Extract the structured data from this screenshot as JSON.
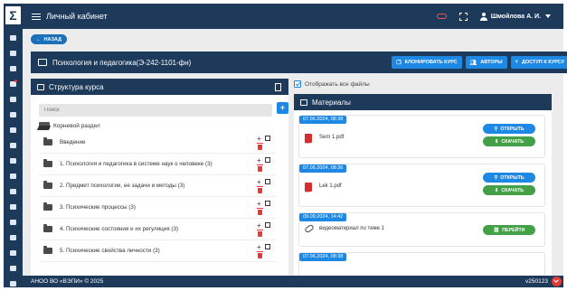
{
  "sidebar": {
    "logo_text": "Σ",
    "icons": [
      "id-card-icon",
      "user-icon",
      "users-icon",
      "link-icon",
      "checklist-icon",
      "trophy-icon",
      "book-icon",
      "id-badge-icon",
      "table-icon",
      "search-icon",
      "file-icon",
      "file-alt-icon",
      "calendar-icon",
      "question-icon",
      "clipboard-icon",
      "list-icon",
      "settings-icon"
    ]
  },
  "topbar": {
    "title": "Личный кабинет",
    "user_name": "Шмойлова А. И."
  },
  "back_button": "НАЗАД",
  "course": {
    "title": "Психология и педагогика(Э-242-1101-фн)",
    "buttons": [
      "КЛОНИРОВАТЬ КУРС",
      "АВТОРЫ",
      "ДОСТУП К КУРСУ"
    ]
  },
  "structure": {
    "title": "Структура курса",
    "search_placeholder": "Поиск",
    "root_label": "Корневой раздел",
    "nodes": [
      "Введение",
      "1. Психология и педагогика в системе наук о человеке (3)",
      "2. Предмет психологии, ее задачи и методы (3)",
      "3. Психические процессы (3)",
      "4. Психические состояния и их регуляция (3)",
      "5. Психические свойства личности (3)"
    ]
  },
  "materials": {
    "show_all_label": "Отображать все файлы",
    "show_all_checked": true,
    "title": "Материалы",
    "open_label": "ОТКРЫТЬ",
    "download_label": "СКАЧАТЬ",
    "go_label": "ПЕРЕЙТИ",
    "items": [
      {
        "date": "07.06.2024, 08:38",
        "name": "Sem 1.pdf",
        "kind": "file"
      },
      {
        "date": "07.06.2024, 08:36",
        "name": "Lek 1.pdf",
        "kind": "file"
      },
      {
        "date": "09.09.2024, 14:42",
        "name": "видеоматериал по теме 1",
        "kind": "link"
      },
      {
        "date": "07.06.2024, 08:38",
        "name": "",
        "kind": "file"
      }
    ]
  },
  "footer": {
    "copyright": "АНОО ВО «ВЭПИ» © 2025",
    "version": "v250123"
  },
  "colors": {
    "navy": "#1d3a5b",
    "primary": "#1e88e5",
    "success": "#43a047",
    "danger": "#e53935"
  }
}
